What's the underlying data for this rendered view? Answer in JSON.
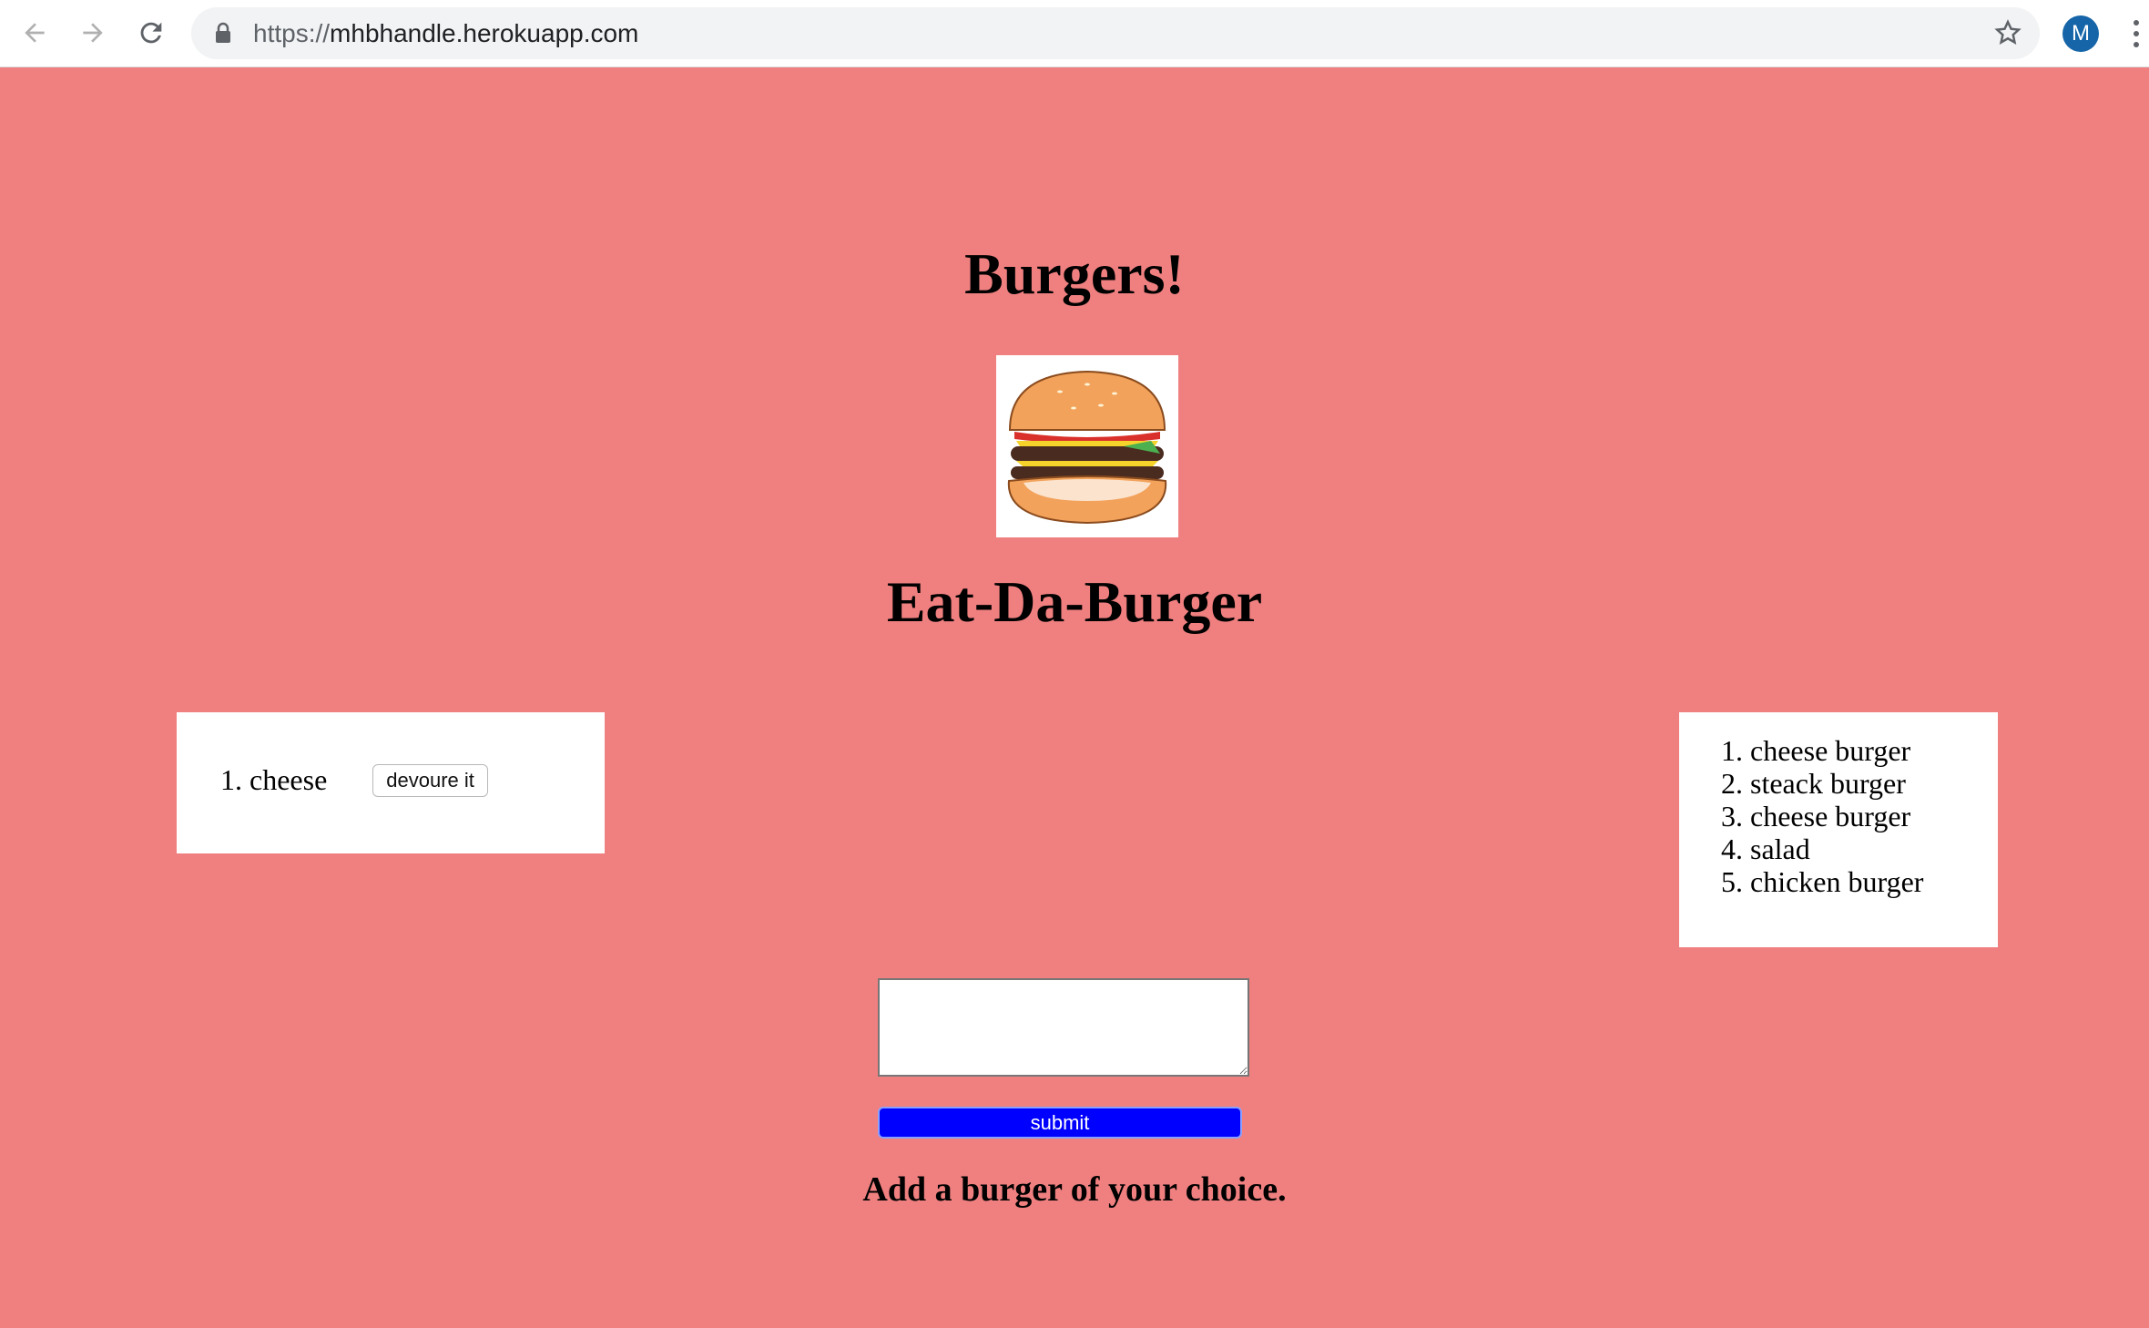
{
  "browser": {
    "url_scheme": "https://",
    "url_host": "mhbhandle.herokuapp.com",
    "avatar_letter": "M"
  },
  "page": {
    "title": "Burgers!",
    "subtitle": "Eat-Da-Burger",
    "left_list": [
      {
        "number": "1.",
        "name": "cheese",
        "button": "devoure it"
      }
    ],
    "right_list": [
      "cheese burger",
      "steack burger",
      "cheese burger",
      "salad",
      "chicken burger"
    ],
    "input_value": "",
    "submit_label": "submit",
    "hint": "Add a burger of your choice."
  },
  "colors": {
    "background": "#f08080",
    "submit": "#0000ff"
  }
}
